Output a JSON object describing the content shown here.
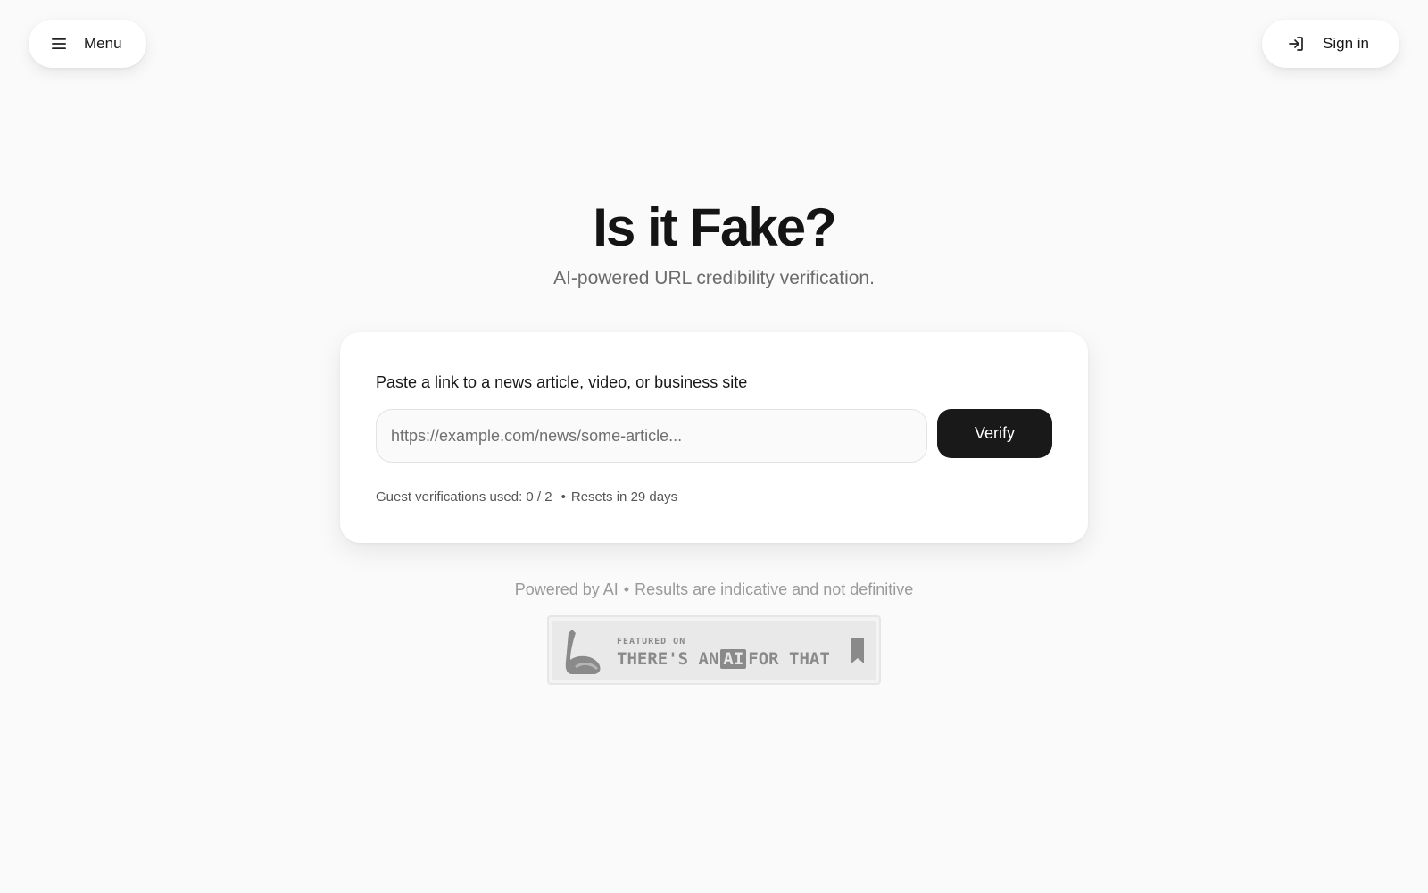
{
  "header": {
    "menu_label": "Menu",
    "menu_icon": "hamburger-icon",
    "signin_label": "Sign in",
    "signin_icon": "sign-in-arrow-icon"
  },
  "hero": {
    "title": "Is it Fake?",
    "subtitle": "AI-powered URL credibility verification."
  },
  "verify_card": {
    "prompt": "Paste a link to a news article, video, or business site",
    "input_value": "",
    "input_placeholder": "https://example.com/news/some-article...",
    "button_label": "Verify",
    "usage_text": "Guest verifications used: 0 / 2",
    "usage_separator": "•",
    "reset_text": "Resets in 29 days"
  },
  "footer": {
    "powered_by": "Powered by AI",
    "separator": "•",
    "disclaimer": "Results are indicative and not definitive"
  },
  "badge": {
    "featured_on": "FEATURED ON",
    "name_part1": "THERE'S AN",
    "name_ai": "AI",
    "name_part2": "FOR THAT",
    "bookmark_icon": "bookmark-icon",
    "logo_icon": "arm-flex-icon"
  },
  "colors": {
    "background": "#fafafa",
    "primary_button": "#191919",
    "text_primary": "#171717",
    "text_muted": "#6b6b6b"
  }
}
